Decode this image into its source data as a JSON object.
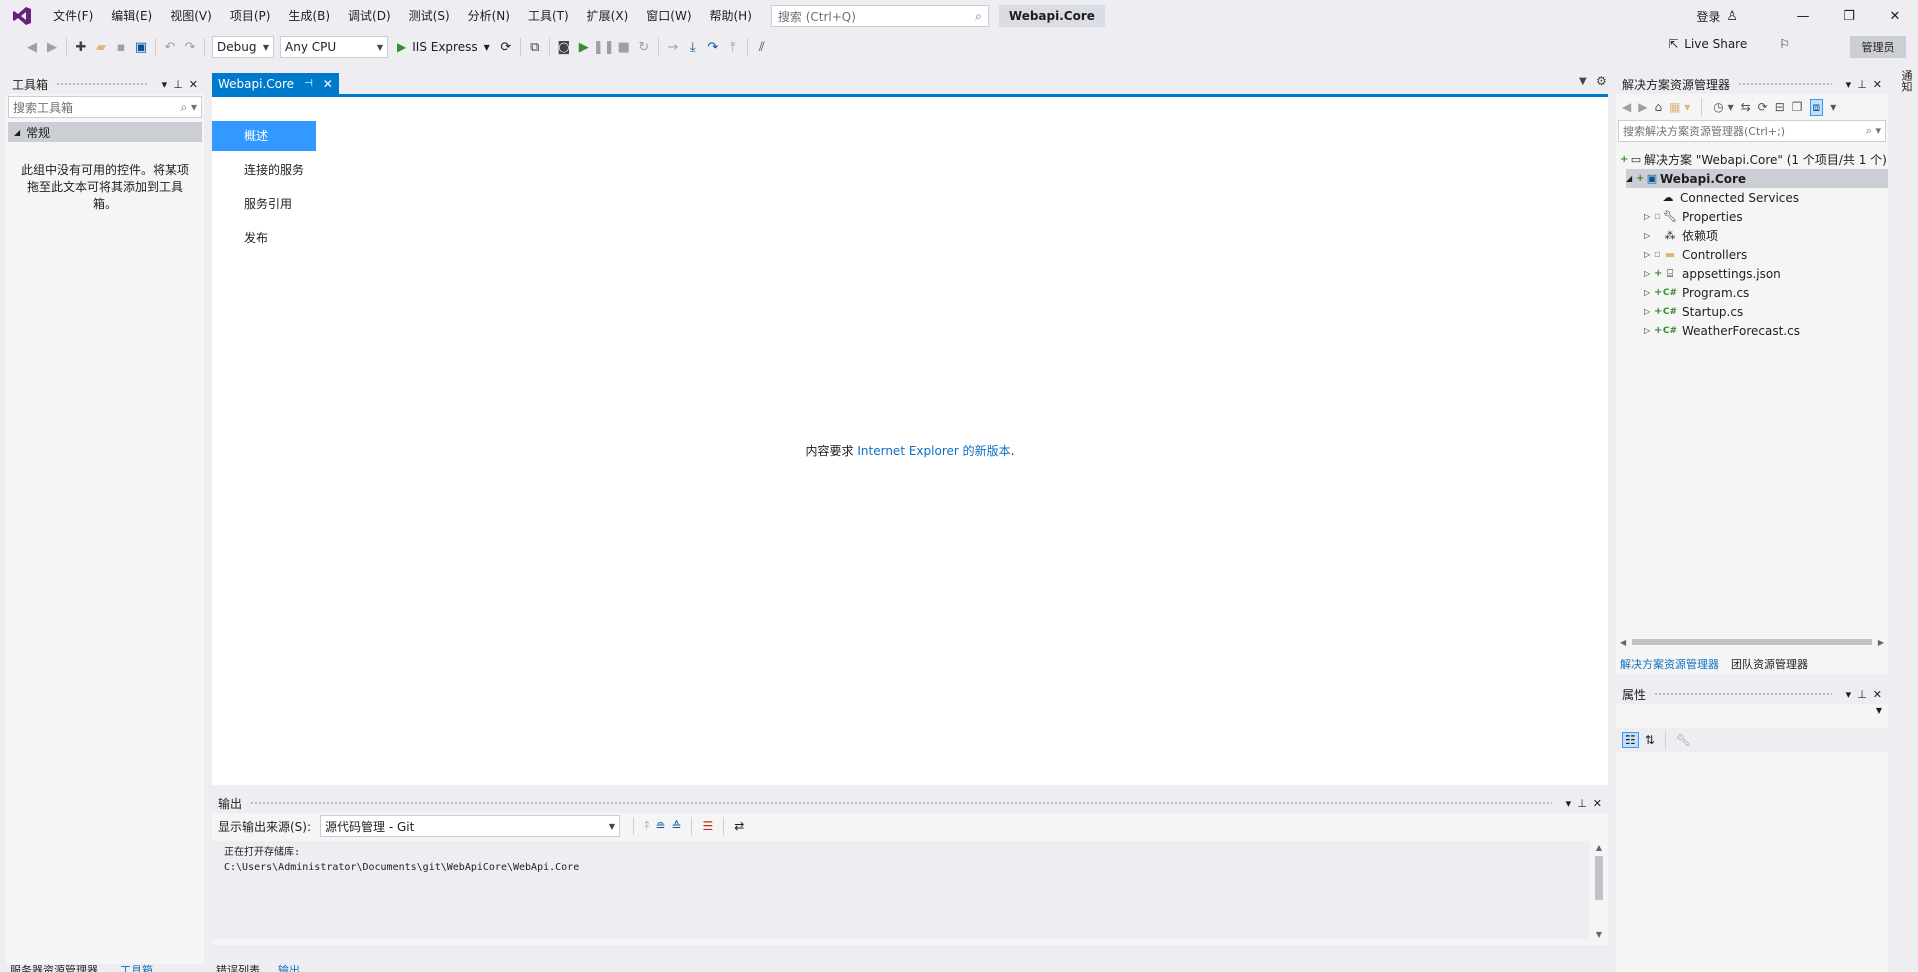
{
  "menu": [
    "文件(F)",
    "编辑(E)",
    "视图(V)",
    "项目(P)",
    "生成(B)",
    "调试(D)",
    "测试(S)",
    "分析(N)",
    "工具(T)",
    "扩展(X)",
    "窗口(W)",
    "帮助(H)"
  ],
  "search": {
    "placeholder": "搜索 (Ctrl+Q)"
  },
  "solution_title": "Webapi.Core",
  "signin": "登录",
  "toolbar": {
    "config": "Debug",
    "platform": "Any CPU",
    "run_target": "IIS Express",
    "live_share": "Live Share",
    "admin": "管理员"
  },
  "toolbox": {
    "title": "工具箱",
    "search_placeholder": "搜索工具箱",
    "group": "常规",
    "empty_message": "此组中没有可用的控件。将某项拖至此文本可将其添加到工具箱。"
  },
  "document_tab": {
    "title": "Webapi.Core"
  },
  "editor": {
    "nav": [
      "概述",
      "连接的服务",
      "服务引用",
      "发布"
    ],
    "active_nav": 0,
    "message_prefix": "内容要求 ",
    "message_link": "Internet Explorer 的新版本",
    "message_suffix": "."
  },
  "output": {
    "title": "输出",
    "source_label": "显示输出来源(S):",
    "source_value": "源代码管理 - Git",
    "lines": [
      "正在打开存储库:",
      "C:\\Users\\Administrator\\Documents\\git\\WebApiCore\\WebApi.Core"
    ]
  },
  "bottom_tabs": [
    "服务器资源管理器",
    "工具箱",
    "错误列表",
    "输出"
  ],
  "solution_explorer": {
    "title": "解决方案资源管理器",
    "search_placeholder": "搜索解决方案资源管理器(Ctrl+;)",
    "solution_line": "解决方案 \"Webapi.Core\" (1 个项目/共 1 个)",
    "project": "Webapi.Core",
    "items": [
      "Connected Services",
      "Properties",
      "依赖项",
      "Controllers",
      "appsettings.json",
      "Program.cs",
      "Startup.cs",
      "WeatherForecast.cs"
    ],
    "tabs": [
      "解决方案资源管理器",
      "团队资源管理器"
    ]
  },
  "properties": {
    "title": "属性"
  },
  "side_tab": "通知",
  "colors": {
    "accent": "#007acc",
    "selection": "#3399ff",
    "link": "#0e70c0"
  }
}
